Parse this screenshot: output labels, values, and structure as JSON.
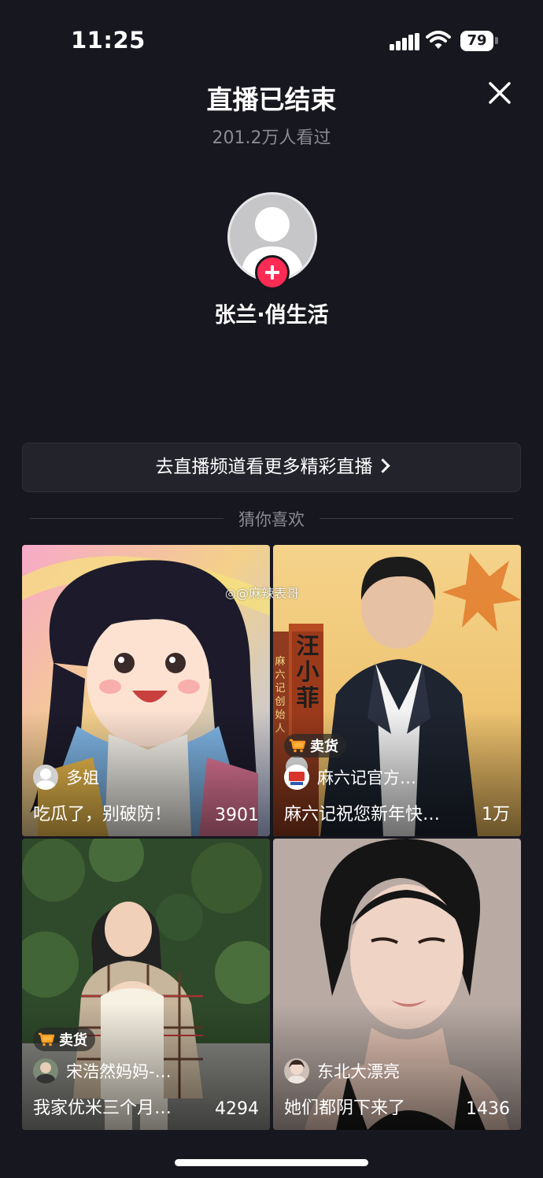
{
  "status_bar": {
    "time": "11:25",
    "battery": "79"
  },
  "header": {
    "title": "直播已结束",
    "viewers": "201.2万人看过"
  },
  "host": {
    "name": "张兰·俏生活"
  },
  "channel_button": {
    "label": "去直播频道看更多精彩直播"
  },
  "section": {
    "label": "猜你喜欢"
  },
  "watermark": "@麻辣表哥",
  "sell_badge_label": "卖货",
  "cards": [
    {
      "author": "多姐",
      "title": "吃瓜了，别破防！",
      "count": "3901"
    },
    {
      "author": "麻六记官方…",
      "title": "麻六记祝您新年快…",
      "count": "1万",
      "poster_name": "汪小菲",
      "poster_caption": "麻六记创始人"
    },
    {
      "author": "宋浩然妈妈-…",
      "title": "我家优米三个月…",
      "count": "4294"
    },
    {
      "author": "东北大漂亮",
      "title": "她们都阴下来了",
      "count": "1436"
    }
  ],
  "colors": {
    "background": "#17171f",
    "accent": "#fe2c55",
    "badge_cart": "#ff9a1f"
  }
}
